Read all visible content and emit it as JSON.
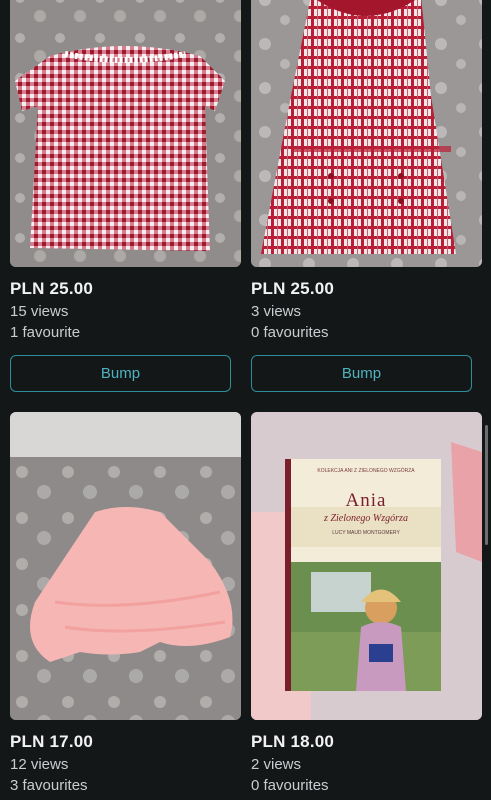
{
  "listings": [
    {
      "price": "PLN 25.00",
      "views": "15 views",
      "favourites": "1 favourite",
      "bump_label": "Bump"
    },
    {
      "price": "PLN 25.00",
      "views": "3 views",
      "favourites": "0 favourites",
      "bump_label": "Bump"
    },
    {
      "price": "PLN 17.00",
      "views": "12 views",
      "favourites": "3 favourites"
    },
    {
      "price": "PLN 18.00",
      "views": "2 views",
      "favourites": "0 favourites"
    }
  ],
  "book_cover": {
    "series": "KOLEKCJA ANI Z ZIELONEGO WZGÓRZA",
    "title": "Ania",
    "subtitle": "z Zielonego Wzgórza",
    "author": "LUCY MAUD MONTGOMERY"
  }
}
